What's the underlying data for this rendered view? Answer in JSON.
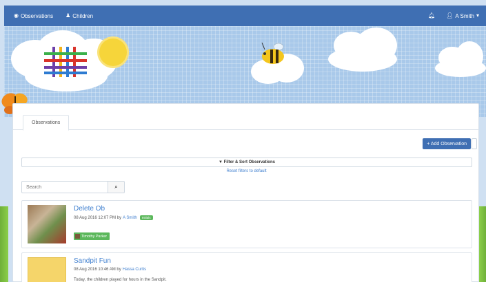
{
  "navbar": {
    "observations_label": "Observations",
    "children_label": "Children",
    "user_label": "A Smith",
    "icons": {
      "observations": "eye-icon",
      "children": "child-icon",
      "notifications": "bell-icon",
      "user": "user-icon",
      "user_menu": "caret-down-icon"
    }
  },
  "tabs": [
    {
      "label": "Observations"
    }
  ],
  "toolbar": {
    "add_label": "+ Add Observation"
  },
  "filter": {
    "label": "▼ Filter & Sort Observations",
    "reset_label": "Reset filters to default"
  },
  "search": {
    "placeholder": "Search",
    "icon": "search-icon"
  },
  "observations": [
    {
      "title": "Delete Ob",
      "date": "08 Aug 2016 12:07 PM by",
      "author": "A Smith",
      "badge": "Initials",
      "child": "Timothy Parker"
    },
    {
      "title": "Sandpit Fun",
      "date": "08 Aug 2016 10:46 AM by",
      "author": "Hassa Curtis",
      "snippet": "Today, the children played for hours in the Sandpit."
    }
  ],
  "colors": {
    "navbar": "#3f6fb3",
    "link": "#3f7fcf",
    "badge": "#5cb85c"
  }
}
